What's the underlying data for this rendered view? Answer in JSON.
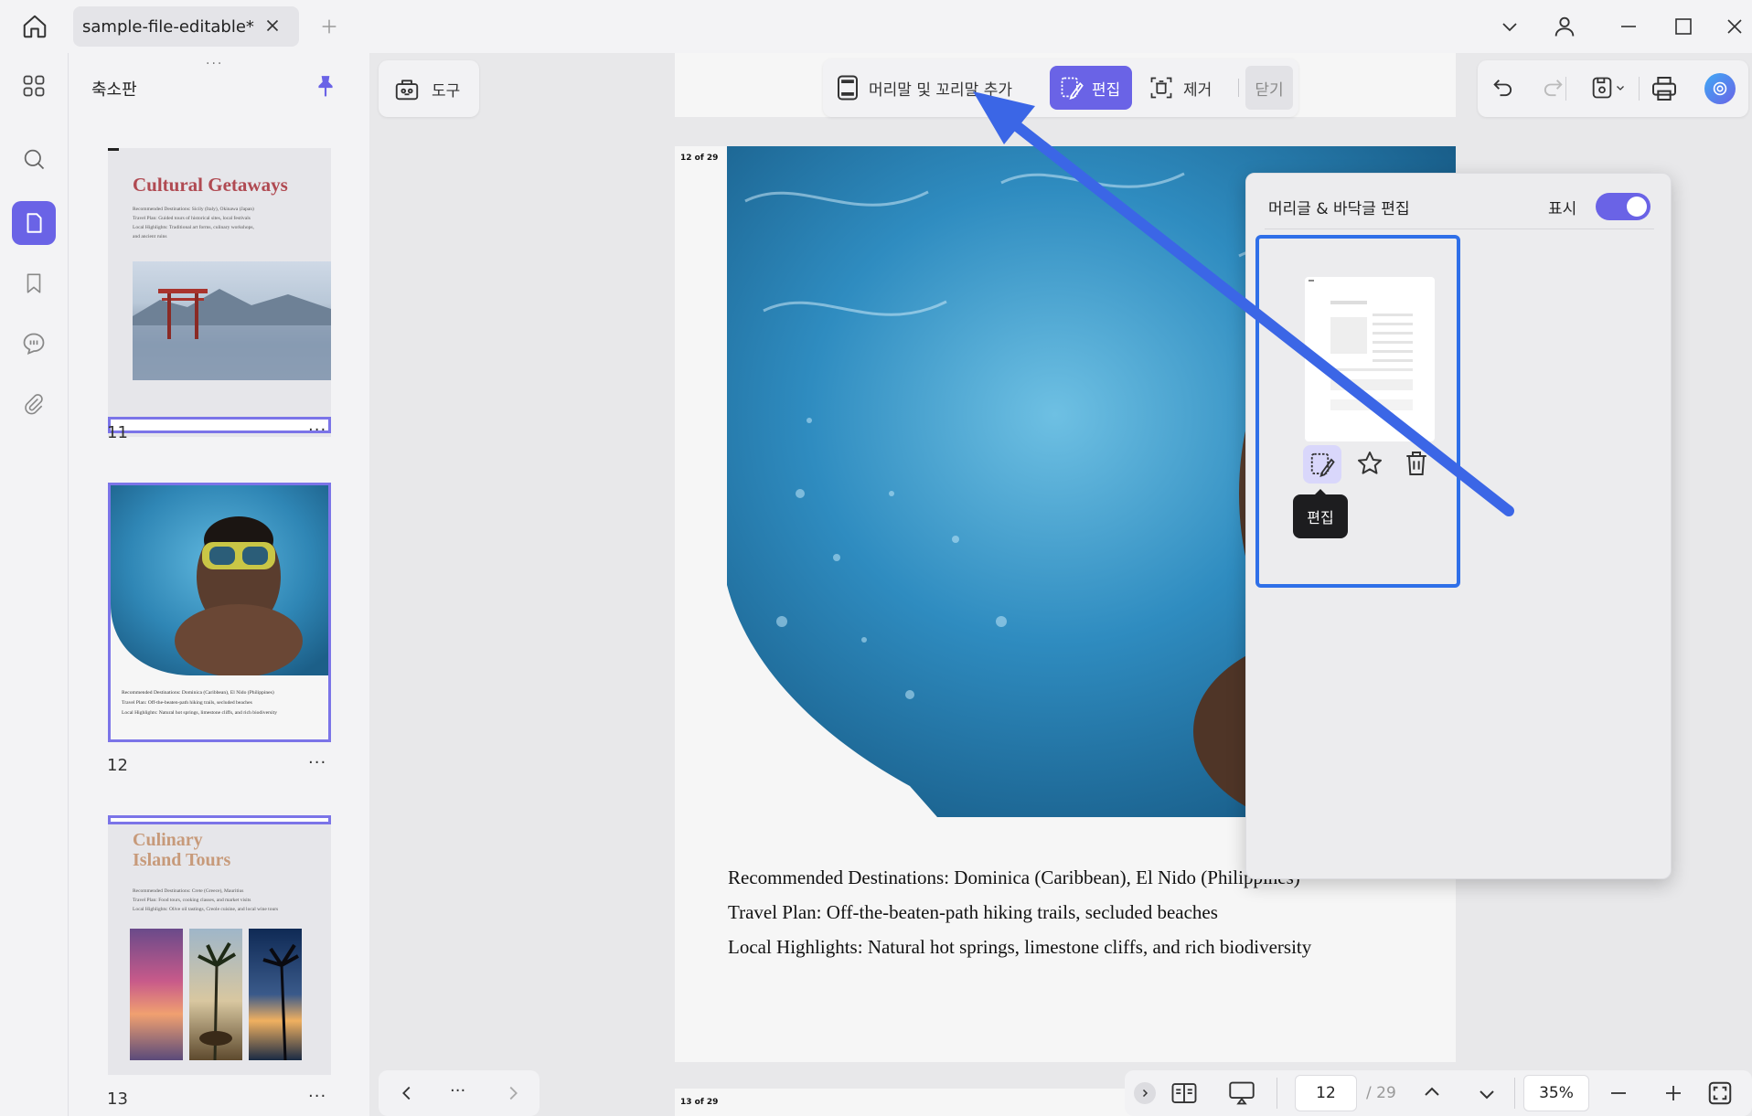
{
  "window": {
    "tab_title": "sample-file-editable*"
  },
  "thumbnails": {
    "panel_title": "축소판",
    "pages": [
      {
        "num": "11",
        "title": "Cultural Getaways",
        "lines": [
          "Recommended Destinations: Sicily (Italy), Okinawa (Japan)",
          "Travel Plan: Guided tours of historical sites, local festivals",
          "Local Highlights: Traditional art forms, culinary workshops,",
          "and ancient ruins"
        ]
      },
      {
        "num": "12",
        "lines": [
          "Recommended Destinations: Dominica (Caribbean), El Nido (Philippines)",
          "Travel Plan: Off-the-beaten-path hiking trails, secluded beaches",
          "Local Highlights: Natural hot springs, limestone cliffs, and rich biodiversity"
        ]
      },
      {
        "num": "13",
        "title_line1": "Culinary",
        "title_line2": "Island Tours",
        "lines": [
          "Recommended Destinations: Crete (Greece), Mauritius",
          "Travel Plan: Food tours, cooking classes, and market visits",
          "Local Highlights: Olive oil tastings, Creole cuisine, and local wine tours"
        ]
      }
    ],
    "more_label": "···"
  },
  "toolbar": {
    "tools_label": "도구",
    "add_header_footer": "머리말 및 꼬리말 추가",
    "edit": "편집",
    "remove": "제거",
    "close": "닫기"
  },
  "popup": {
    "title": "머리글 & 바닥글 편집",
    "display_label": "표시",
    "display_on": true,
    "tooltip": "편집"
  },
  "document": {
    "page_label_top": "12 of 29",
    "page_label_next": "13 of 29",
    "lines": [
      "Recommended Destinations: Dominica (Caribbean), El Nido (Philippines)",
      "Travel Plan: Off-the-beaten-path hiking trails, secluded beaches",
      "Local Highlights: Natural hot springs, limestone cliffs, and rich biodiversity"
    ]
  },
  "navigation": {
    "more": "···",
    "current_page": "12",
    "total_pages": "/ 29",
    "zoom": "35%"
  },
  "colors": {
    "accent": "#6a63e6",
    "accent_light": "#d9d7fb",
    "highlight_blue": "#2f6fe8",
    "arrow_blue": "#3b66e6"
  }
}
